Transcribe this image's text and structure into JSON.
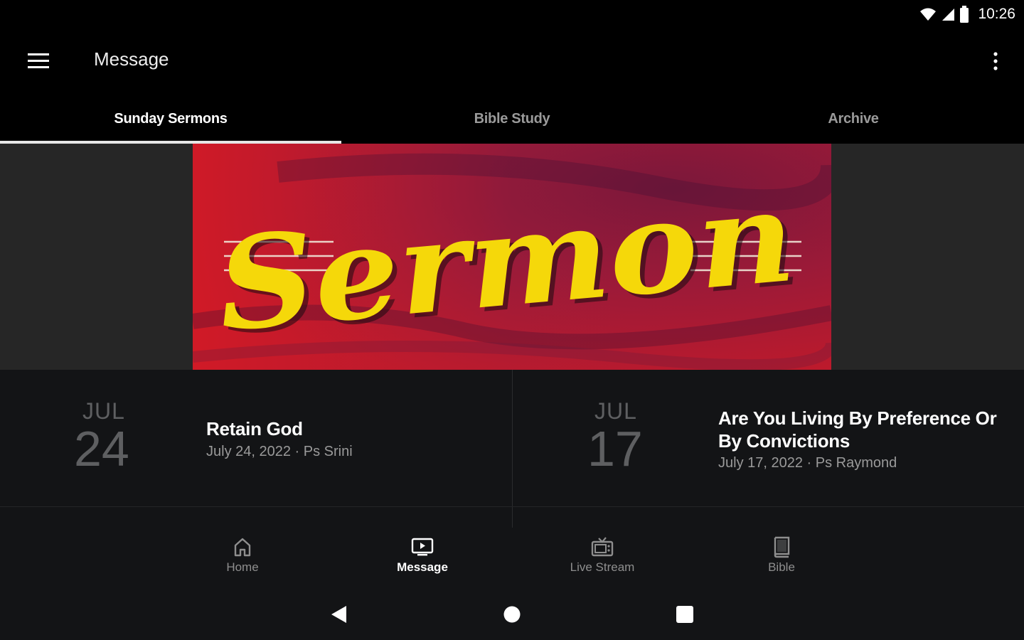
{
  "status_bar": {
    "time": "10:26",
    "icons": [
      "wifi-icon",
      "signal-icon",
      "battery-icon"
    ]
  },
  "app_bar": {
    "title": "Message",
    "menu_icon": "hamburger-menu-icon",
    "overflow_icon": "more-vert-icon"
  },
  "tabs": [
    {
      "label": "Sunday Sermons",
      "active": true
    },
    {
      "label": "Bible Study",
      "active": false
    },
    {
      "label": "Archive",
      "active": false
    }
  ],
  "banner": {
    "text": "Sermon",
    "colors": {
      "background": "#c51b2a",
      "text": "#f5d80a"
    }
  },
  "sermons": [
    {
      "month": "JUL",
      "day": "24",
      "title": "Retain God",
      "subtitle": "July 24, 2022 · Ps Srini"
    },
    {
      "month": "JUL",
      "day": "17",
      "title_line1": "Are You Living By Preference Or",
      "title_line2": "By Convictions",
      "subtitle": "July 17, 2022 · Ps Raymond"
    }
  ],
  "bottom_nav": [
    {
      "label": "Home",
      "icon": "home-icon",
      "active": false
    },
    {
      "label": "Message",
      "icon": "video-message-icon",
      "active": true
    },
    {
      "label": "Live Stream",
      "icon": "tv-icon",
      "active": false
    },
    {
      "label": "Bible",
      "icon": "book-icon",
      "active": false
    }
  ],
  "system_nav": [
    "back-icon",
    "home-circle-icon",
    "recents-icon"
  ],
  "colors": {
    "background": "#000000",
    "surface": "#131416",
    "accent": "#ffffff",
    "muted_text": "#9a9a9a"
  }
}
